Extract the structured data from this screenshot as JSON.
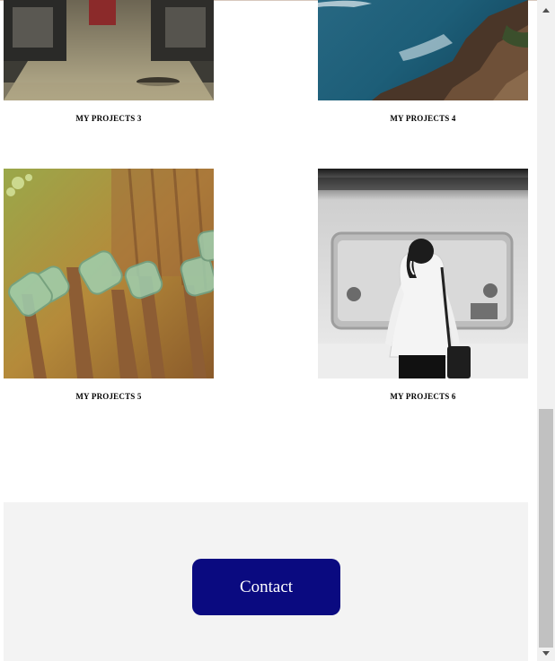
{
  "projects": [
    {
      "title": "MY PROJECTS 3",
      "image": "train-car-interior-photo"
    },
    {
      "title": "MY PROJECTS 4",
      "image": "rocky-coast-sea-photo"
    },
    {
      "title": "MY PROJECTS 5",
      "image": "glass-bottles-on-sticks-photo"
    },
    {
      "title": "MY PROJECTS 6",
      "image": "woman-waiting-subway-photo"
    }
  ],
  "contact": {
    "button_label": "Contact",
    "band_color": "#f3f3f3",
    "button_color": "#0a0a80"
  }
}
